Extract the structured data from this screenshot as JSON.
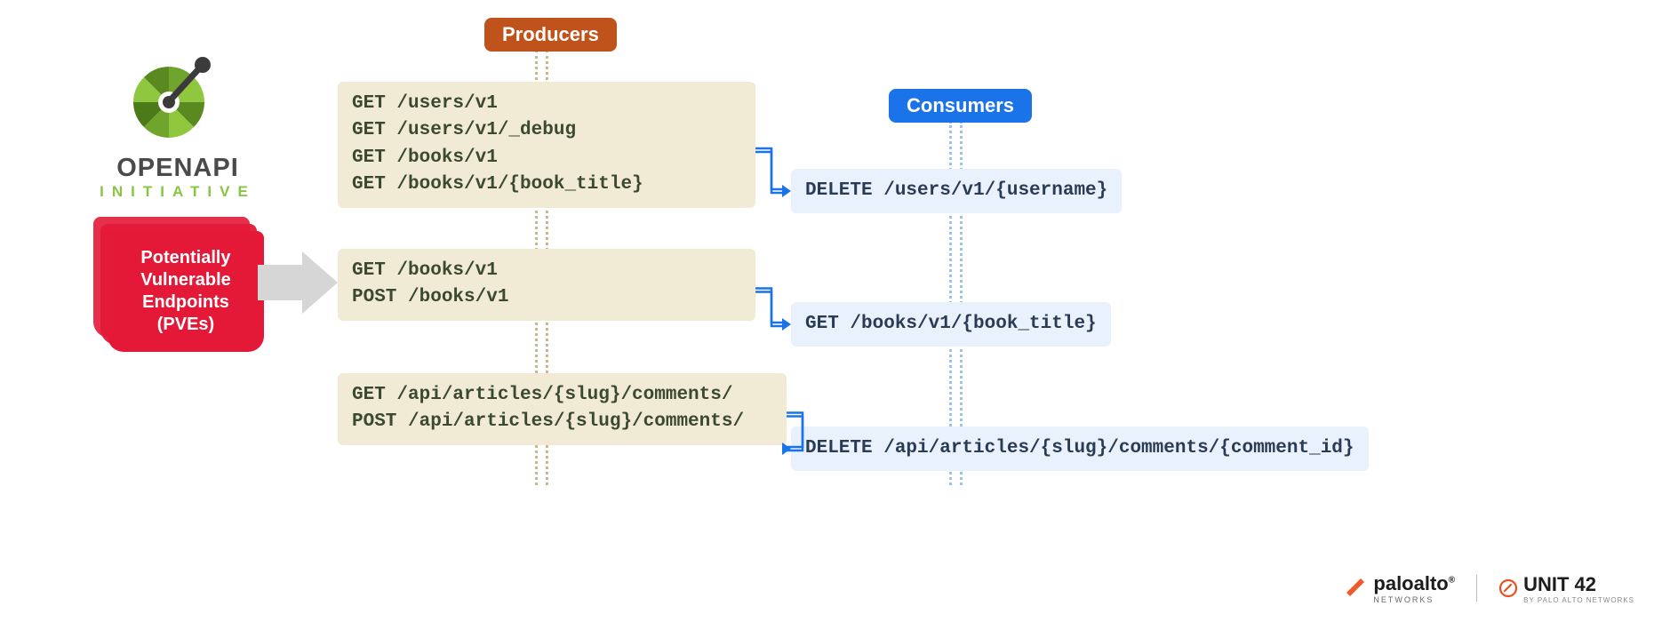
{
  "left": {
    "logo_title": "OPENAPI",
    "logo_sub": "INITIATIVE",
    "pve_text": "Potentially\nVulnerable\nEndpoints\n(PVEs)"
  },
  "labels": {
    "producers": "Producers",
    "consumers": "Consumers"
  },
  "producers": [
    {
      "lines": [
        "GET /users/v1",
        "GET /users/v1/_debug",
        "GET /books/v1",
        "GET /books/v1/{book_title}"
      ]
    },
    {
      "lines": [
        "GET /books/v1",
        "POST /books/v1"
      ]
    },
    {
      "lines": [
        "GET /api/articles/{slug}/comments/",
        "POST /api/articles/{slug}/comments/"
      ]
    }
  ],
  "consumers": [
    {
      "lines": [
        "DELETE /users/v1/{username}"
      ]
    },
    {
      "lines": [
        "GET /books/v1/{book_title}"
      ]
    },
    {
      "lines": [
        "DELETE /api/articles/{slug}/comments/{comment_id}"
      ]
    }
  ],
  "footer": {
    "paloalto": "paloalto",
    "paloalto_sub": "NETWORKS",
    "unit42": "UNIT 42",
    "unit42_sub": "BY PALO ALTO NETWORKS"
  },
  "layout": {
    "prod_tops": [
      92,
      280,
      420
    ],
    "prod_widths": [
      470,
      470,
      505
    ],
    "cons_tops": [
      190,
      340,
      480
    ]
  }
}
